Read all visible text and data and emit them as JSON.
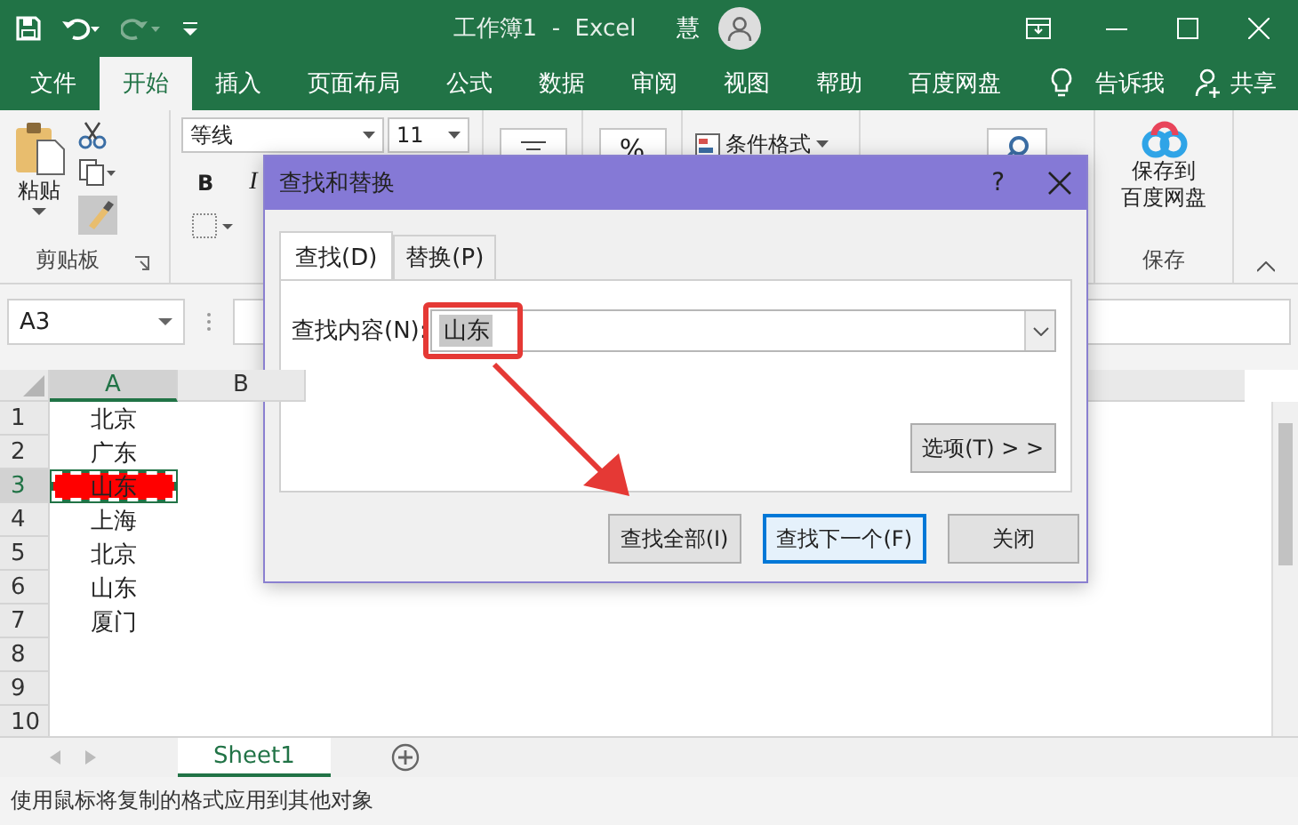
{
  "title_bar": {
    "title": "工作簿1  -  Excel",
    "user_initial": "慧"
  },
  "ribbon_tabs": [
    {
      "label": "文件",
      "selected": false
    },
    {
      "label": "开始",
      "selected": true
    },
    {
      "label": "插入",
      "selected": false
    },
    {
      "label": "页面布局",
      "selected": false
    },
    {
      "label": "公式",
      "selected": false
    },
    {
      "label": "数据",
      "selected": false
    },
    {
      "label": "审阅",
      "selected": false
    },
    {
      "label": "视图",
      "selected": false
    },
    {
      "label": "帮助",
      "selected": false
    },
    {
      "label": "百度网盘",
      "selected": false
    }
  ],
  "tell_me": "告诉我",
  "share": "共享",
  "clipboard": {
    "paste": "粘贴",
    "group": "剪贴板"
  },
  "font": {
    "name": "等线",
    "size": "11",
    "bold": "B",
    "italic": "I"
  },
  "number": {
    "percent": "%"
  },
  "styles": {
    "conditional_formatting": "条件格式"
  },
  "baidu": {
    "lines": [
      "保存到",
      "百度网盘"
    ],
    "group": "保存"
  },
  "name_box": "A3",
  "sheet": {
    "columns": [
      {
        "label": "A",
        "selected": true
      },
      {
        "label": "B",
        "selected": false
      }
    ],
    "rows": [
      {
        "number": "1",
        "selected": false,
        "cell": "北京",
        "highlighted": false
      },
      {
        "number": "2",
        "selected": false,
        "cell": "广东",
        "highlighted": false
      },
      {
        "number": "3",
        "selected": true,
        "cell": "山东",
        "highlighted": true
      },
      {
        "number": "4",
        "selected": false,
        "cell": "上海",
        "highlighted": false
      },
      {
        "number": "5",
        "selected": false,
        "cell": "北京",
        "highlighted": false
      },
      {
        "number": "6",
        "selected": false,
        "cell": "山东",
        "highlighted": false
      },
      {
        "number": "7",
        "selected": false,
        "cell": "厦门",
        "highlighted": false
      },
      {
        "number": "8",
        "selected": false,
        "highlighted": false
      },
      {
        "number": "9",
        "selected": false,
        "highlighted": false
      },
      {
        "number": "10",
        "selected": false,
        "highlighted": false
      }
    ]
  },
  "sheet_tabs": [
    {
      "label": "Sheet1",
      "selected": true
    }
  ],
  "status_bar": "使用鼠标将复制的格式应用到其他对象",
  "dialog": {
    "title": "查找和替换",
    "help": "?",
    "tabs": [
      {
        "label": "查找(D)",
        "selected": true
      },
      {
        "label": "替换(P)",
        "selected": false
      }
    ],
    "find_label": "查找内容(N):",
    "find_value": "山东",
    "options_button": "选项(T) > >",
    "buttons": [
      {
        "label": "查找全部(I)",
        "default": false
      },
      {
        "label": "查找下一个(F)",
        "default": true
      },
      {
        "label": "关闭",
        "default": false
      }
    ]
  }
}
